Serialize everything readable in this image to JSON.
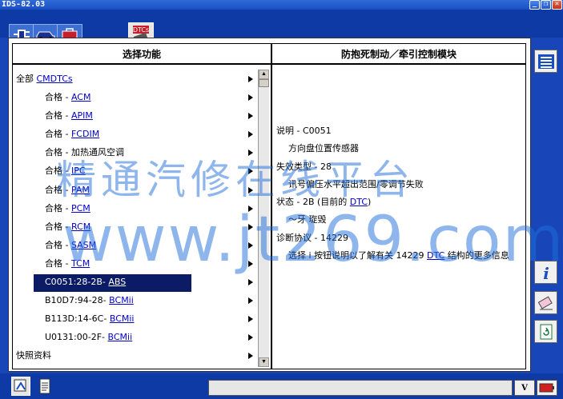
{
  "window": {
    "title": "IDS-82.03"
  },
  "toolbar": {
    "tabs": [
      {
        "name": "connection",
        "icon": "plug-icon"
      },
      {
        "name": "vehicle",
        "icon": "car-icon"
      },
      {
        "name": "toolbox",
        "icon": "toolbox-icon"
      },
      {
        "name": "dtcs",
        "icon": "dtc-icon",
        "label": "DTCs",
        "selected": true
      }
    ]
  },
  "left_pane": {
    "title": "选择功能",
    "rows": [
      {
        "prefix": "全部 ",
        "code": "CMDTCs",
        "top": true
      },
      {
        "prefix": "合格 - ",
        "code": "ACM"
      },
      {
        "prefix": "合格 - ",
        "code": "APIM"
      },
      {
        "prefix": "合格 - ",
        "code": "FCDIM"
      },
      {
        "prefix": "合格 - 加热通风空调",
        "code": ""
      },
      {
        "prefix": "合格 - ",
        "code": "IPC"
      },
      {
        "prefix": "合格 - ",
        "code": "PAM"
      },
      {
        "prefix": "合格 - ",
        "code": "PCM"
      },
      {
        "prefix": "合格 - ",
        "code": "RCM"
      },
      {
        "prefix": "合格 - ",
        "code": "SASM"
      },
      {
        "prefix": "合格 - ",
        "code": "TCM"
      },
      {
        "prefix": "C0051:28-2B- ",
        "code": "ABS",
        "selected": true
      },
      {
        "prefix": "B10D7:94-28- ",
        "code": "BCMii"
      },
      {
        "prefix": "B113D:14-6C- ",
        "code": "BCMii"
      },
      {
        "prefix": "U0131:00-2F- ",
        "code": "BCMii"
      },
      {
        "prefix": "快照资料",
        "code": "",
        "top": true
      }
    ]
  },
  "right_pane": {
    "title": "防抱死制动／牵引控制模块",
    "lines": {
      "desc_label": "说明 - C0051",
      "desc_value": "方向盘位置传感器",
      "fail_label": "失效类型 - 28",
      "fail_value": "讯号偏压水平超出范围/零调节失败",
      "status_prefix": "状态 - 2B (目前的 ",
      "status_link": "DTC",
      "status_suffix": ")",
      "status_value": "〜牙    琁毁",
      "protocol_label": "诊断协议 - 14229",
      "protocol_prefix": "选择 i 按钮说明以了解有关 14229 ",
      "protocol_link": "DTC",
      "protocol_suffix": " 结构的更多信息"
    }
  },
  "side_tools": [
    {
      "name": "list-icon"
    },
    {
      "name": "info-icon"
    },
    {
      "name": "eraser-icon"
    },
    {
      "name": "refresh-doc-icon"
    }
  ],
  "status_bar": {
    "vbutton": "V",
    "battery_icon": "battery-icon"
  },
  "watermark": {
    "line1": "精通汽修在线平台",
    "line2": "www.jt269.com"
  },
  "colors": {
    "frame": "#1846b8",
    "selection": "#0b1b66",
    "link": "#0000c8"
  }
}
